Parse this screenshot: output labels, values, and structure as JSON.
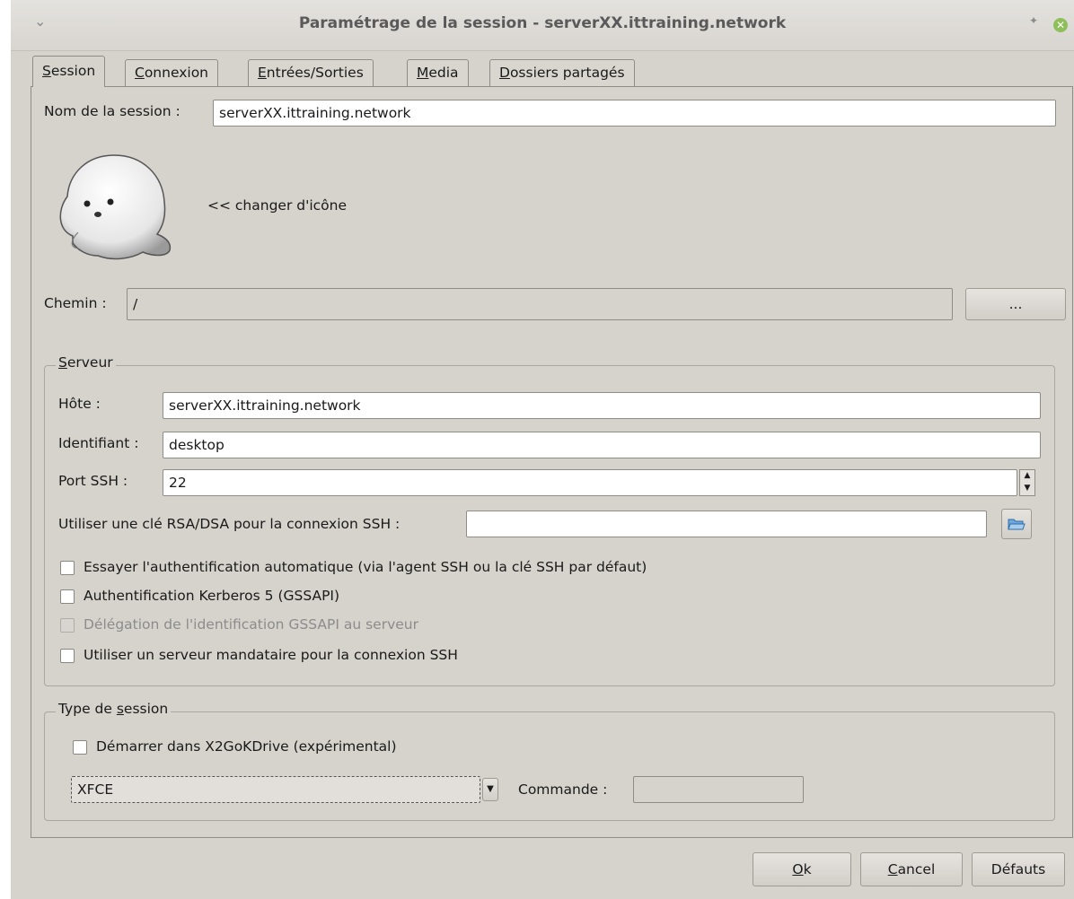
{
  "window": {
    "title": "Paramétrage de la session - serverXX.ittraining.network",
    "menu_icon": "chevron-down-icon",
    "pin_icon": "pin-icon",
    "close_icon": "close-icon"
  },
  "tabs": [
    {
      "mnemonic": "S",
      "rest": "ession",
      "active": true
    },
    {
      "mnemonic": "C",
      "rest": "onnexion",
      "active": false
    },
    {
      "mnemonic": "E",
      "rest": "ntrées/Sorties",
      "active": false
    },
    {
      "mnemonic": "M",
      "rest": "edia",
      "active": false
    },
    {
      "mnemonic": "D",
      "rest": "ossiers partagés",
      "active": false
    }
  ],
  "session": {
    "name_label": "Nom de la session :",
    "name_value": "serverXX.ittraining.network",
    "icon_name": "seal-icon",
    "change_icon_label": "<< changer d'icône",
    "path_label": "Chemin :",
    "path_value": "/",
    "browse_label": "..."
  },
  "server": {
    "legend_mnemonic": "S",
    "legend_rest": "erveur",
    "host_label": "Hôte :",
    "host_value": "serverXX.ittraining.network",
    "login_label": "Identifiant :",
    "login_value": "desktop",
    "port_label": "Port SSH :",
    "port_value": "22",
    "rsa_label": "Utiliser une clé RSA/DSA pour la connexion SSH :",
    "rsa_value": "",
    "rsa_browse_icon": "folder-open-icon",
    "checkboxes": [
      {
        "label": "Essayer l'authentification automatique (via l'agent SSH ou la clé SSH par défaut)",
        "checked": false,
        "enabled": true
      },
      {
        "label": "Authentification Kerberos 5 (GSSAPI)",
        "checked": false,
        "enabled": true
      },
      {
        "label": "Délégation de l'identification GSSAPI au serveur",
        "checked": false,
        "enabled": false
      },
      {
        "label": "Utiliser un serveur mandataire pour la connexion SSH",
        "checked": false,
        "enabled": true
      }
    ]
  },
  "session_type": {
    "legend_before": "Type de ",
    "legend_mnemonic": "s",
    "legend_after": "ession",
    "kdrive_label": "Démarrer dans X2GoKDrive (expérimental)",
    "kdrive_checked": false,
    "type_value": "XFCE",
    "command_label": "Commande :",
    "command_value": ""
  },
  "buttons": {
    "ok_mnemonic": "O",
    "ok_rest": "k",
    "cancel_mnemonic": "C",
    "cancel_rest": "ancel",
    "defaults_label": "Défauts"
  }
}
